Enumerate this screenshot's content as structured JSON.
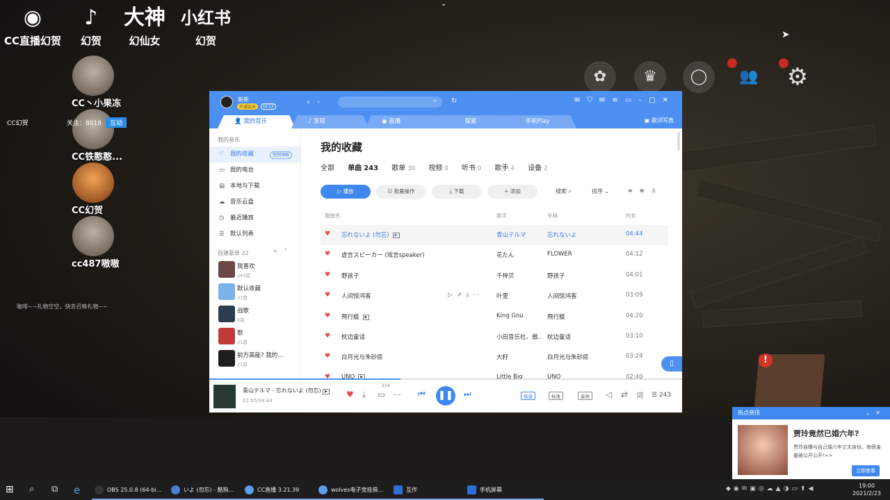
{
  "stream_overlay": {
    "logos": [
      {
        "glyph": "◉",
        "label": "CC直播幻贺",
        "icon": "weibo-icon"
      },
      {
        "glyph": "♪",
        "label": "幻贺",
        "icon": "douyin-icon"
      },
      {
        "glyph": "大神",
        "label": "幻仙女",
        "icon": "dashen-icon"
      },
      {
        "glyph": "小红书",
        "label": "幻贺",
        "icon": "xiaohongshu-icon"
      }
    ],
    "casters": [
      {
        "name": "CC丶小果冻"
      },
      {
        "name": "CC铁憨憨..."
      },
      {
        "name": "CC幻贺"
      },
      {
        "name": "cc487嗷嗷"
      }
    ],
    "cc_tag": "CC幻贺",
    "follow": "关注：8018",
    "interact": "互动",
    "gift_msg": "咖啡~~礼物空空，快去召唤礼物~~"
  },
  "music_window": {
    "user": {
      "name": "新新",
      "vip": "开通会员",
      "level": "LV.12"
    },
    "tabs": [
      {
        "label": "我的音乐",
        "icon": "person-icon",
        "active": true
      },
      {
        "label": "发现",
        "icon": "music-note-icon"
      },
      {
        "label": "直播",
        "icon": "live-icon"
      },
      {
        "label": "探索",
        "icon": ""
      },
      {
        "label": "手机Play",
        "icon": ""
      }
    ],
    "tab_extra": "歌词写真",
    "sidebar": {
      "heading": "我的音乐",
      "items": [
        {
          "label": "我的收藏",
          "badge": "签到领取",
          "active": true
        },
        {
          "label": "我的电台"
        },
        {
          "label": "本地与下载"
        },
        {
          "label": "音乐云盘"
        },
        {
          "label": "最近播放"
        },
        {
          "label": "默认列表"
        }
      ],
      "section": "自建歌单",
      "section_count": "22",
      "playlists": [
        {
          "name": "我喜欢",
          "count": "243首",
          "color": "#6a4848"
        },
        {
          "name": "默认收藏",
          "count": "37首",
          "color": "#7ab2ea"
        },
        {
          "name": "战歌",
          "count": "5首",
          "color": "#2c3e4e"
        },
        {
          "name": "歌",
          "count": "31首",
          "color": "#c03a3a"
        },
        {
          "name": "前方高能? 我的...",
          "count": "21首",
          "color": "#1e1e1e"
        }
      ]
    },
    "main": {
      "title": "我的收藏",
      "categories": [
        {
          "label": "全部",
          "count": ""
        },
        {
          "label": "单曲",
          "count": "243",
          "active": true
        },
        {
          "label": "歌单",
          "count": "30"
        },
        {
          "label": "视频",
          "count": "0"
        },
        {
          "label": "听书",
          "count": "0"
        },
        {
          "label": "歌手",
          "count": "4"
        },
        {
          "label": "设备",
          "count": "2"
        }
      ],
      "actions": {
        "play": "播放",
        "batch": "批量操作",
        "download": "下载",
        "add": "添加",
        "search": "搜索",
        "sort": "排序"
      },
      "columns": {
        "name": "歌曲名",
        "artist": "歌手",
        "album": "专辑",
        "duration": "时长"
      },
      "songs": [
        {
          "title": "忘れないよ (勿忘)",
          "mv": true,
          "artist": "青山テルマ",
          "album": "忘れないよ",
          "duration": "04:44",
          "playing": true
        },
        {
          "title": "虚言スピーカー (戏言speaker)",
          "artist": "花たん",
          "album": "FLOWER",
          "duration": "04:12"
        },
        {
          "title": "野孩子",
          "artist": "千梓贝",
          "album": "野孩子",
          "duration": "04:01"
        },
        {
          "title": "人间惊鸿客",
          "artist": "叶里",
          "album": "人间惊鸿客",
          "duration": "03:09",
          "hover": true
        },
        {
          "title": "飛行艇",
          "mv": true,
          "artist": "King Gnu",
          "album": "飛行艇",
          "duration": "04:20"
        },
        {
          "title": "枕边童话",
          "artist": "小田音乐社、傲...",
          "album": "枕边童话",
          "duration": "03:10"
        },
        {
          "title": "白月光与朱砂痣",
          "artist": "大籽",
          "album": "白月光与朱砂痣",
          "duration": "03:24"
        },
        {
          "title": "UNO",
          "mv": true,
          "artist": "Little Big",
          "album": "UNO",
          "duration": "02:40"
        }
      ]
    },
    "playbar": {
      "title": "青山テルマ - 忘れないよ (勿忘)",
      "time": "01:55/04:44",
      "progress": 0.405,
      "comment_count": "214",
      "quality": "极速",
      "sound": "标准",
      "effect": "音效",
      "lyrics": "词",
      "queue_count": "243"
    }
  },
  "news": {
    "header": "热点资讯",
    "title": "贾玲竟然已婚六年?",
    "desc": "贾玲自曝与自己婚六年丈夫身份。她很害羞被公开公开!>>",
    "button": "立即查看"
  },
  "taskbar": {
    "apps": [
      {
        "label": "OBS 25.0.8 (64-bi..."
      },
      {
        "label": "いよ (勿忘) - 酷狗..."
      },
      {
        "label": "CC直播 3.21.39"
      },
      {
        "label": "wolves电子竞技俱..."
      },
      {
        "label": "互作"
      },
      {
        "label": "手机屏幕"
      }
    ],
    "time": "19:00",
    "date": "2021/2/23"
  },
  "colors": {
    "accent": "#4d90f2",
    "heart": "#e84a4a"
  }
}
